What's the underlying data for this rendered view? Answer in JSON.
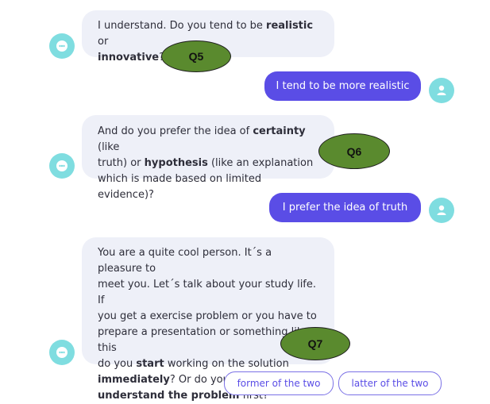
{
  "messages": {
    "bot1": {
      "part1": "I understand. Do you tend to be ",
      "bold1": "realistic",
      "part2": " or",
      "bold2": "innovative",
      "part3": "?"
    },
    "user1": "I tend to be more realistic",
    "bot2": {
      "part1": "And do you prefer the idea of ",
      "bold1": "certainty",
      "part2": " (like",
      "part3": "truth) or ",
      "bold2": "hypothesis",
      "part4": " (like an explanation",
      "part5": "which is made based on limited evidence)?"
    },
    "user2": "I prefer the idea of truth",
    "bot3": {
      "line1": "You are a quite cool person. It´s a pleasure to",
      "line2": "meet you. Let´s talk about your study life. If",
      "line3": "you get a exercise problem or you have to",
      "line4": "prepare a presentation or something like this",
      "line5a": "do you ",
      "line5b": "start",
      "line5c": " working on the solution",
      "line6a": "immediately",
      "line6b": "? Or do you try to fully",
      "line7a": "understand the problem",
      "line7b": " first?"
    }
  },
  "annotations": {
    "q5": "Q5",
    "q6": "Q6",
    "q7": "Q7"
  },
  "options": {
    "former": "former of the two",
    "latter": "latter of the two"
  },
  "icons": {
    "bot_avatar": "chatbot-face-icon",
    "user_avatar": "user-person-icon"
  },
  "colors": {
    "bot_bubble": "#eef0f8",
    "user_bubble": "#5a4de6",
    "avatar": "#7fdde0",
    "annotation": "#5a8a2e"
  }
}
